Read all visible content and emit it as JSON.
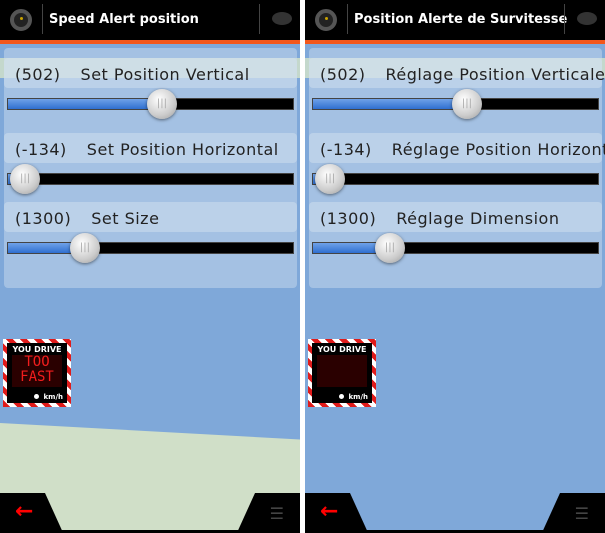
{
  "panels": [
    {
      "title": "Speed Alert position",
      "rows": [
        {
          "value": "(502)",
          "label": "Set Position Vertical",
          "fraction": 0.54
        },
        {
          "value": "(-134)",
          "label": "Set Position Horizontal",
          "fraction": 0.06
        },
        {
          "value": "(1300)",
          "label": "Set Size",
          "fraction": 0.27
        }
      ],
      "sign": {
        "top": "YOU DRIVE TO",
        "line1": "TOO",
        "line2": "FAST",
        "unit": "km/h"
      }
    },
    {
      "title": "Position Alerte de Survitesse",
      "rows": [
        {
          "value": "(502)",
          "label": "Réglage Position Verticale",
          "fraction": 0.54
        },
        {
          "value": "(-134)",
          "label": "Réglage Position Horizontale",
          "fraction": 0.06
        },
        {
          "value": "(1300)",
          "label": "Réglage Dimension",
          "fraction": 0.27
        }
      ],
      "sign": {
        "top": "YOU DRIVE TO",
        "line1": "",
        "line2": "",
        "unit": "km/h"
      }
    }
  ],
  "colors": {
    "accent": "#f2571c",
    "slider_fill": "#3a7ad8",
    "back_arrow": "#ff0000"
  },
  "icons": {
    "left": "steering-wheel-icon",
    "right": "chat-bubble-icon",
    "back": "back-arrow-icon",
    "menu": "list-menu-icon"
  }
}
